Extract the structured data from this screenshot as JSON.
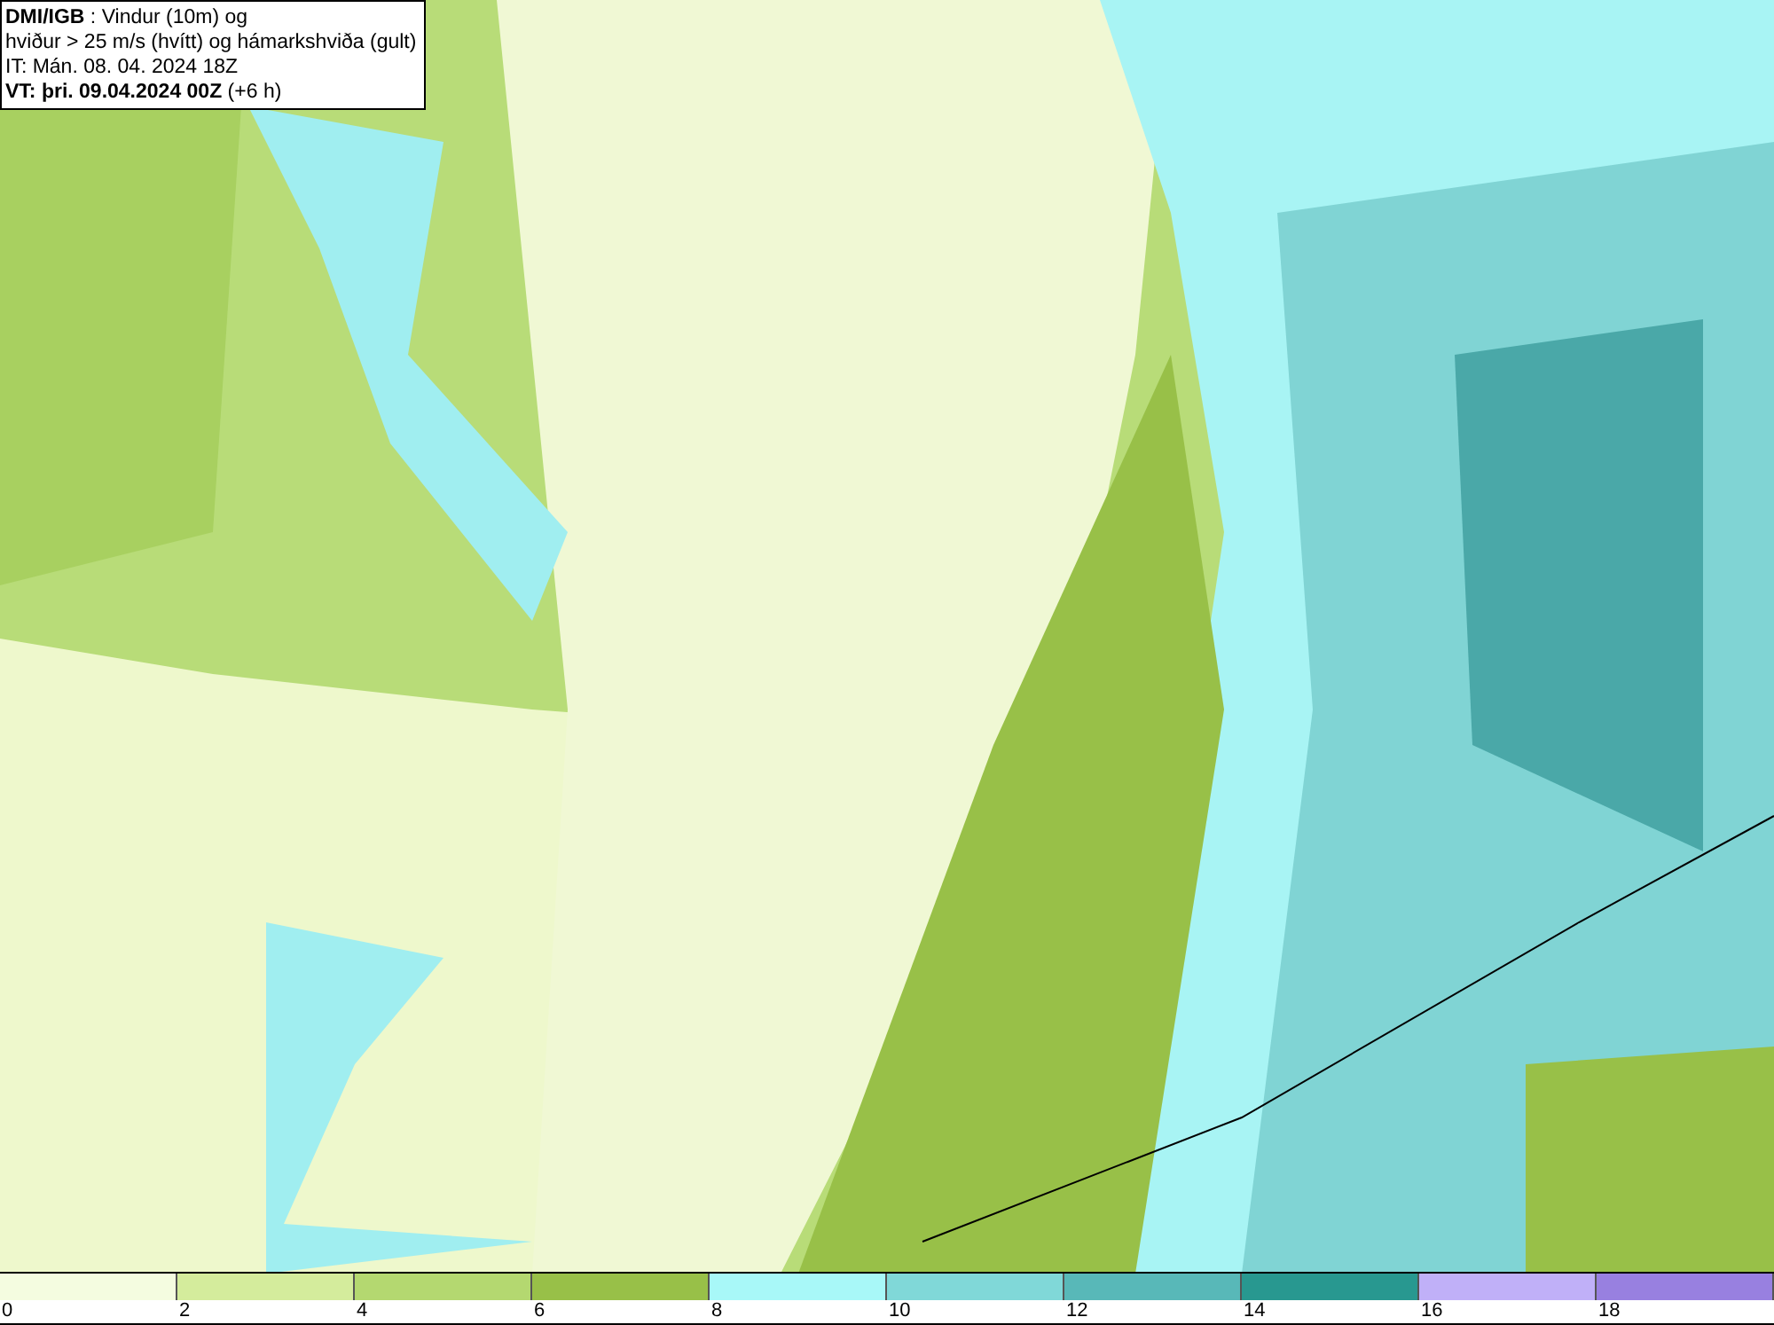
{
  "title_box": {
    "lines": [
      "**DMI/IGB** : Vindur (10m) og",
      "hviður > 25 m/s (hvítt) og hámarkshviða (gult)",
      "IT: Mán. 08. 04. 2024 18Z",
      "**VT: þri. 09.04.2024 00Z** (+6 h)"
    ]
  },
  "legend": {
    "bins": [
      {
        "label": "0",
        "color": "#f4fce0"
      },
      {
        "label": "2",
        "color": "#d4ec9c"
      },
      {
        "label": "4",
        "color": "#b4d870"
      },
      {
        "label": "6",
        "color": "#98c048"
      },
      {
        "label": "8",
        "color": "#a8f8f8"
      },
      {
        "label": "10",
        "color": "#80d8d8"
      },
      {
        "label": "12",
        "color": "#58b8b8"
      },
      {
        "label": "14",
        "color": "#289890"
      },
      {
        "label": "16",
        "color": "#c0b0f8"
      },
      {
        "label": "18",
        "color": "#9880e0"
      }
    ]
  }
}
